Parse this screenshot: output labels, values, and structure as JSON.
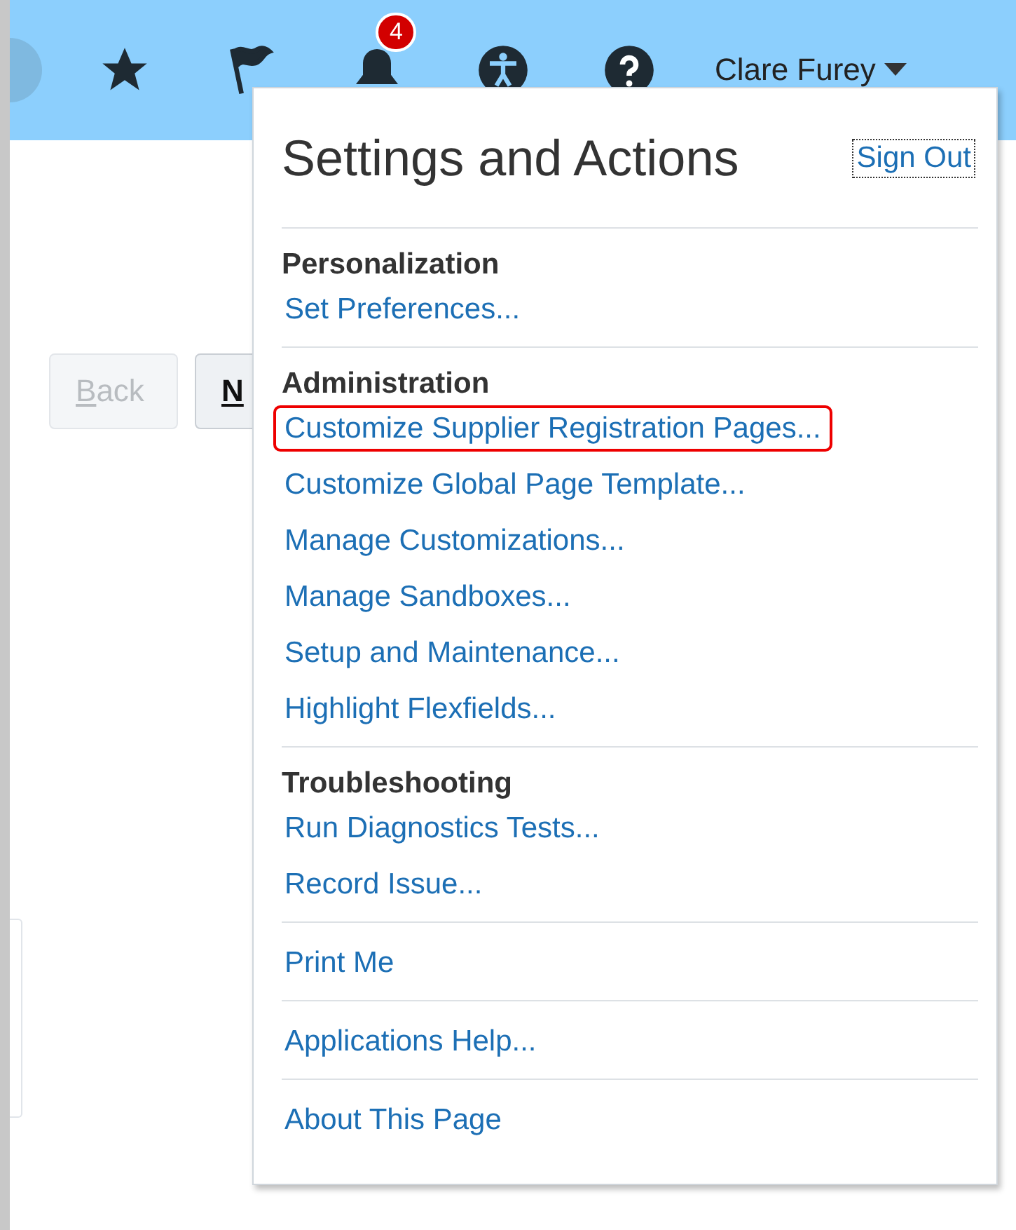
{
  "header": {
    "notification_count": "4",
    "user_name": "Clare Furey"
  },
  "page": {
    "buttons": [
      {
        "label": "Back",
        "disabled": true
      },
      {
        "label": "N",
        "disabled": false
      }
    ]
  },
  "menu": {
    "title": "Settings and Actions",
    "sign_out": "Sign Out",
    "sections": [
      {
        "heading": "Personalization",
        "items": [
          {
            "label": "Set Preferences...",
            "highlighted": false
          }
        ]
      },
      {
        "heading": "Administration",
        "items": [
          {
            "label": "Customize Supplier Registration Pages...",
            "highlighted": true
          },
          {
            "label": "Customize Global Page Template...",
            "highlighted": false
          },
          {
            "label": "Manage Customizations...",
            "highlighted": false
          },
          {
            "label": "Manage Sandboxes...",
            "highlighted": false
          },
          {
            "label": "Setup and Maintenance...",
            "highlighted": false
          },
          {
            "label": "Highlight Flexfields...",
            "highlighted": false
          }
        ]
      },
      {
        "heading": "Troubleshooting",
        "items": [
          {
            "label": "Run Diagnostics Tests...",
            "highlighted": false
          },
          {
            "label": "Record Issue...",
            "highlighted": false
          }
        ]
      },
      {
        "items": [
          {
            "label": "Print Me",
            "highlighted": false
          }
        ]
      },
      {
        "items": [
          {
            "label": "Applications Help...",
            "highlighted": false
          }
        ]
      },
      {
        "items": [
          {
            "label": "About This Page",
            "highlighted": false
          }
        ]
      }
    ]
  }
}
